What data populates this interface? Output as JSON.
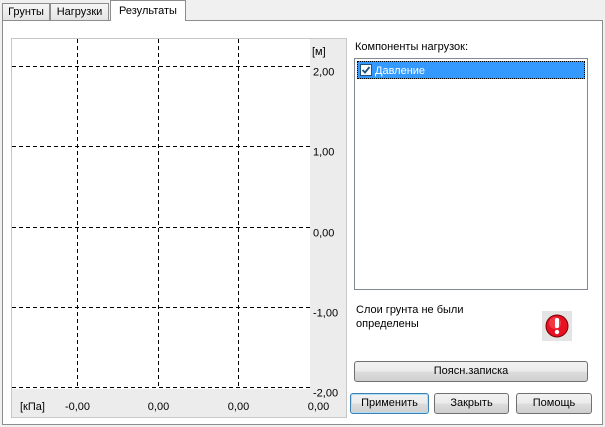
{
  "tabs": [
    {
      "label": "Грунты"
    },
    {
      "label": "Нагрузки"
    },
    {
      "label": "Результаты"
    }
  ],
  "chart": {
    "y_unit": "[м]",
    "x_unit": "[кПа]",
    "y_ticks": [
      "2,00",
      "1,00",
      "0,00",
      "-1,00",
      "-2,00"
    ],
    "x_ticks": [
      "-0,00",
      "0,00",
      "0,00",
      "0,00"
    ]
  },
  "chart_data": {
    "type": "line",
    "xlabel": "[кПа]",
    "ylabel": "[м]",
    "ylim": [
      -2.0,
      2.0
    ],
    "y_ticks": [
      2.0,
      1.0,
      0.0,
      -1.0,
      -2.0
    ],
    "x_ticks": [
      "-0,00",
      "0,00",
      "0,00",
      "0,00"
    ],
    "grid": true,
    "series": []
  },
  "load_components": {
    "title": "Компоненты нагрузок:",
    "items": [
      {
        "label": "Давление",
        "checked": true,
        "selected": true
      }
    ]
  },
  "message": {
    "line1": "Слои грунта не были",
    "line2": "определены",
    "icon": "exclamation-icon"
  },
  "buttons": {
    "report": "Поясн.записка",
    "apply": "Применить",
    "close": "Закрыть",
    "help": "Помощь"
  },
  "colors": {
    "selection": "#3399ff",
    "warning": "#e81123"
  }
}
